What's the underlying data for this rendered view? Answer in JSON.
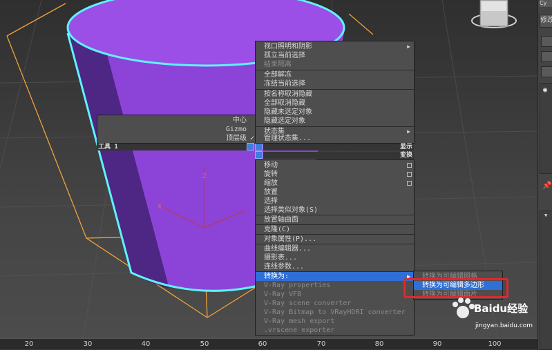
{
  "ruler": {
    "ticks": [
      "20",
      "30",
      "40",
      "50",
      "60",
      "70",
      "80",
      "90",
      "100"
    ]
  },
  "panel": {
    "top_label": "Cy",
    "second_label": "修改"
  },
  "quad_left": {
    "items": [
      "中心",
      "Gizmo",
      "顶层级"
    ],
    "checked_index": 2,
    "check_mark": "✓",
    "tools_header": "工具 1"
  },
  "quad_top": {
    "items": [
      "视口照明和阴影",
      "孤立当前选择",
      "结束隔离",
      "全部解冻",
      "冻结当前选择",
      "按名称取消隐藏",
      "全部取消隐藏",
      "隐藏未选定对象",
      "隐藏选定对象",
      "状态集",
      "管理状态集..."
    ],
    "dim_index": 2,
    "header_display": "显示"
  },
  "quad_bottom": {
    "header_transform": "变换",
    "items": [
      "移动",
      "旋转",
      "缩放",
      "放置",
      "选择",
      "选择类似对象(S)",
      "放置轴曲面",
      "克隆(C)",
      "对象属性(P)...",
      "曲线编辑器...",
      "摄影表...",
      "连线参数...",
      "转换为:",
      "V-Ray properties",
      "V-Ray VFB",
      "V-Ray scene converter",
      "V-Ray Bitmap to VRayHDRI converter",
      "V-Ray mesh export",
      ".vrscene exporter"
    ]
  },
  "submenu": {
    "items": [
      "转换为可编辑网格",
      "转换为可编辑多边形",
      "转换为可编辑面片"
    ],
    "highlight_index": 1,
    "highlight_box_color": "#e0282d"
  },
  "axis_labels": {
    "x": "X",
    "z": "Z"
  },
  "watermark": {
    "brand": "Baidu经验",
    "url": "jingyan.baidu.com"
  },
  "colors": {
    "cylinder": "#8c44d8",
    "cylinder_top": "#9b4fe6",
    "selection_outline": "#5ff2ff",
    "bbox": "#f2a23a",
    "menu_highlight": "#2f6fd6"
  }
}
